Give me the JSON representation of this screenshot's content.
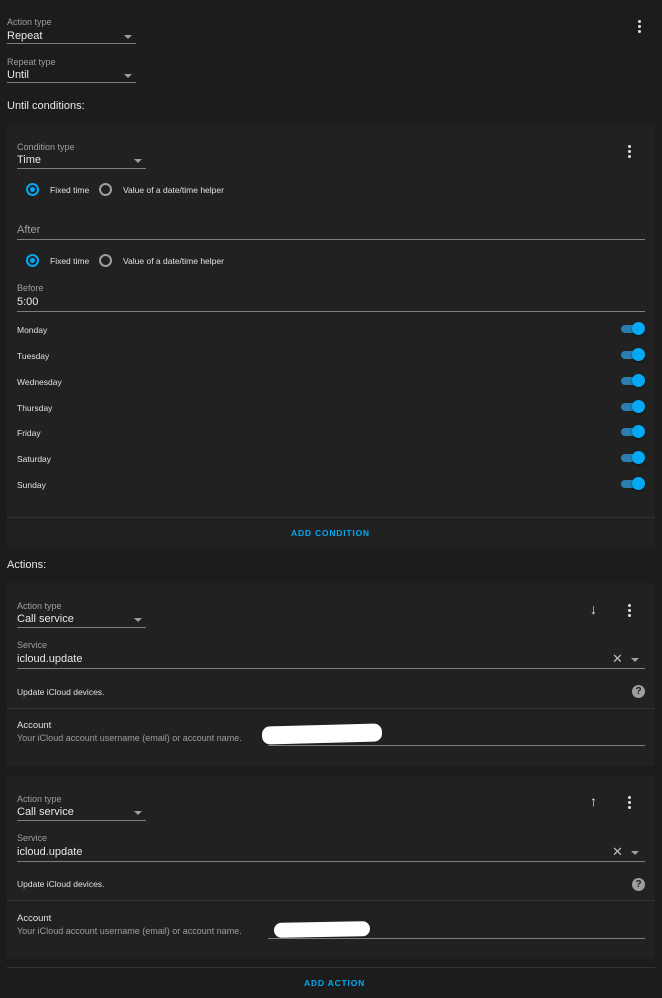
{
  "action_type": {
    "label": "Action type",
    "value": "Repeat"
  },
  "repeat_type": {
    "label": "Repeat type",
    "value": "Until"
  },
  "until_heading": "Until conditions:",
  "condition": {
    "label": "Condition type",
    "value": "Time",
    "radio_fixed": "Fixed time",
    "radio_helper": "Value of a date/time helper",
    "after_placeholder": "After",
    "before_label": "Before",
    "before_value": "5:00",
    "days": [
      "Monday",
      "Tuesday",
      "Wednesday",
      "Thursday",
      "Friday",
      "Saturday",
      "Sunday"
    ],
    "add_condition": "ADD CONDITION"
  },
  "actions_heading": "Actions:",
  "actions": [
    {
      "type_label": "Action type",
      "type_value": "Call service",
      "service_label": "Service",
      "service_value": "icloud.update",
      "description": "Update iCloud devices.",
      "account_label": "Account",
      "account_desc": "Your iCloud account username (email) or account name.",
      "move_icon": "arrow-down-icon"
    },
    {
      "type_label": "Action type",
      "type_value": "Call service",
      "service_label": "Service",
      "service_value": "icloud.update",
      "description": "Update iCloud devices.",
      "account_label": "Account",
      "account_desc": "Your iCloud account username (email) or account name.",
      "move_icon": "arrow-up-icon"
    }
  ],
  "add_action": "ADD ACTION",
  "colors": {
    "accent": "#03a9f4",
    "background": "#1c1c1c",
    "card": "#212121"
  }
}
